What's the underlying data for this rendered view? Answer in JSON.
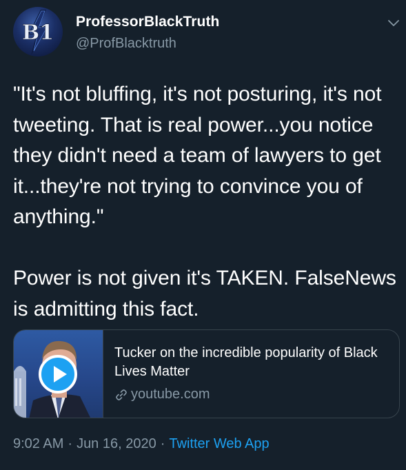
{
  "author": {
    "display_name": "ProfessorBlackTruth",
    "handle": "@ProfBlacktruth",
    "avatar_text": "B1"
  },
  "tweet": {
    "text": "\"It's not bluffing, it's not posturing, it's not tweeting. That is real power...you notice they didn't need a team of lawyers to get it...they're not trying to convince you of anything.\"\n\nPower is not given it's TAKEN. FalseNews is admitting this fact."
  },
  "card": {
    "title": "Tucker on the incredible popularity of Black Lives Matter",
    "domain": "youtube.com"
  },
  "meta": {
    "time": "9:02 AM",
    "separator": "·",
    "date": "Jun 16, 2020",
    "source": "Twitter Web App"
  },
  "icons": {
    "menu": "chevron-down-icon",
    "play": "play-icon",
    "link": "link-icon"
  },
  "colors": {
    "background": "#15202b",
    "text": "#ffffff",
    "secondary": "#8899a6",
    "accent": "#1da1f2",
    "border": "#38444d"
  }
}
